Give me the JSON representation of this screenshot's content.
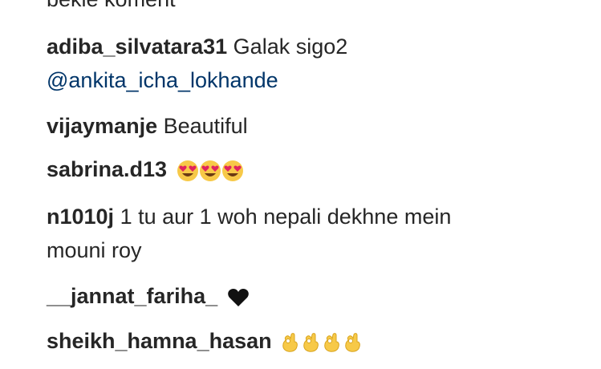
{
  "comments": [
    {
      "user": "",
      "text": "bekle koment"
    },
    {
      "user": "adiba_silvatara31",
      "text": "Galak sigo2",
      "mention": "@ankita_icha_lokhande"
    },
    {
      "user": "vijaymanje",
      "text": "Beautiful"
    },
    {
      "user": "sabrina.d13",
      "text": "",
      "emoji": "heart-eyes-face-icon",
      "emoji_count": 3
    },
    {
      "user": "n1010j",
      "text": "1 tu aur 1 woh nepali dekhne mein",
      "text_line2": "mouni roy"
    },
    {
      "user": "__jannat_fariha_",
      "text": "",
      "emoji": "black-heart-icon",
      "emoji_count": 1
    },
    {
      "user": "sheikh_hamna_hasan",
      "text": "",
      "emoji": "ok-hand-icon",
      "emoji_count": 4
    }
  ],
  "colors": {
    "text": "#262626",
    "mention": "#003569",
    "emoji_yellow": "#f7c948",
    "heart_red": "#e0245e"
  }
}
